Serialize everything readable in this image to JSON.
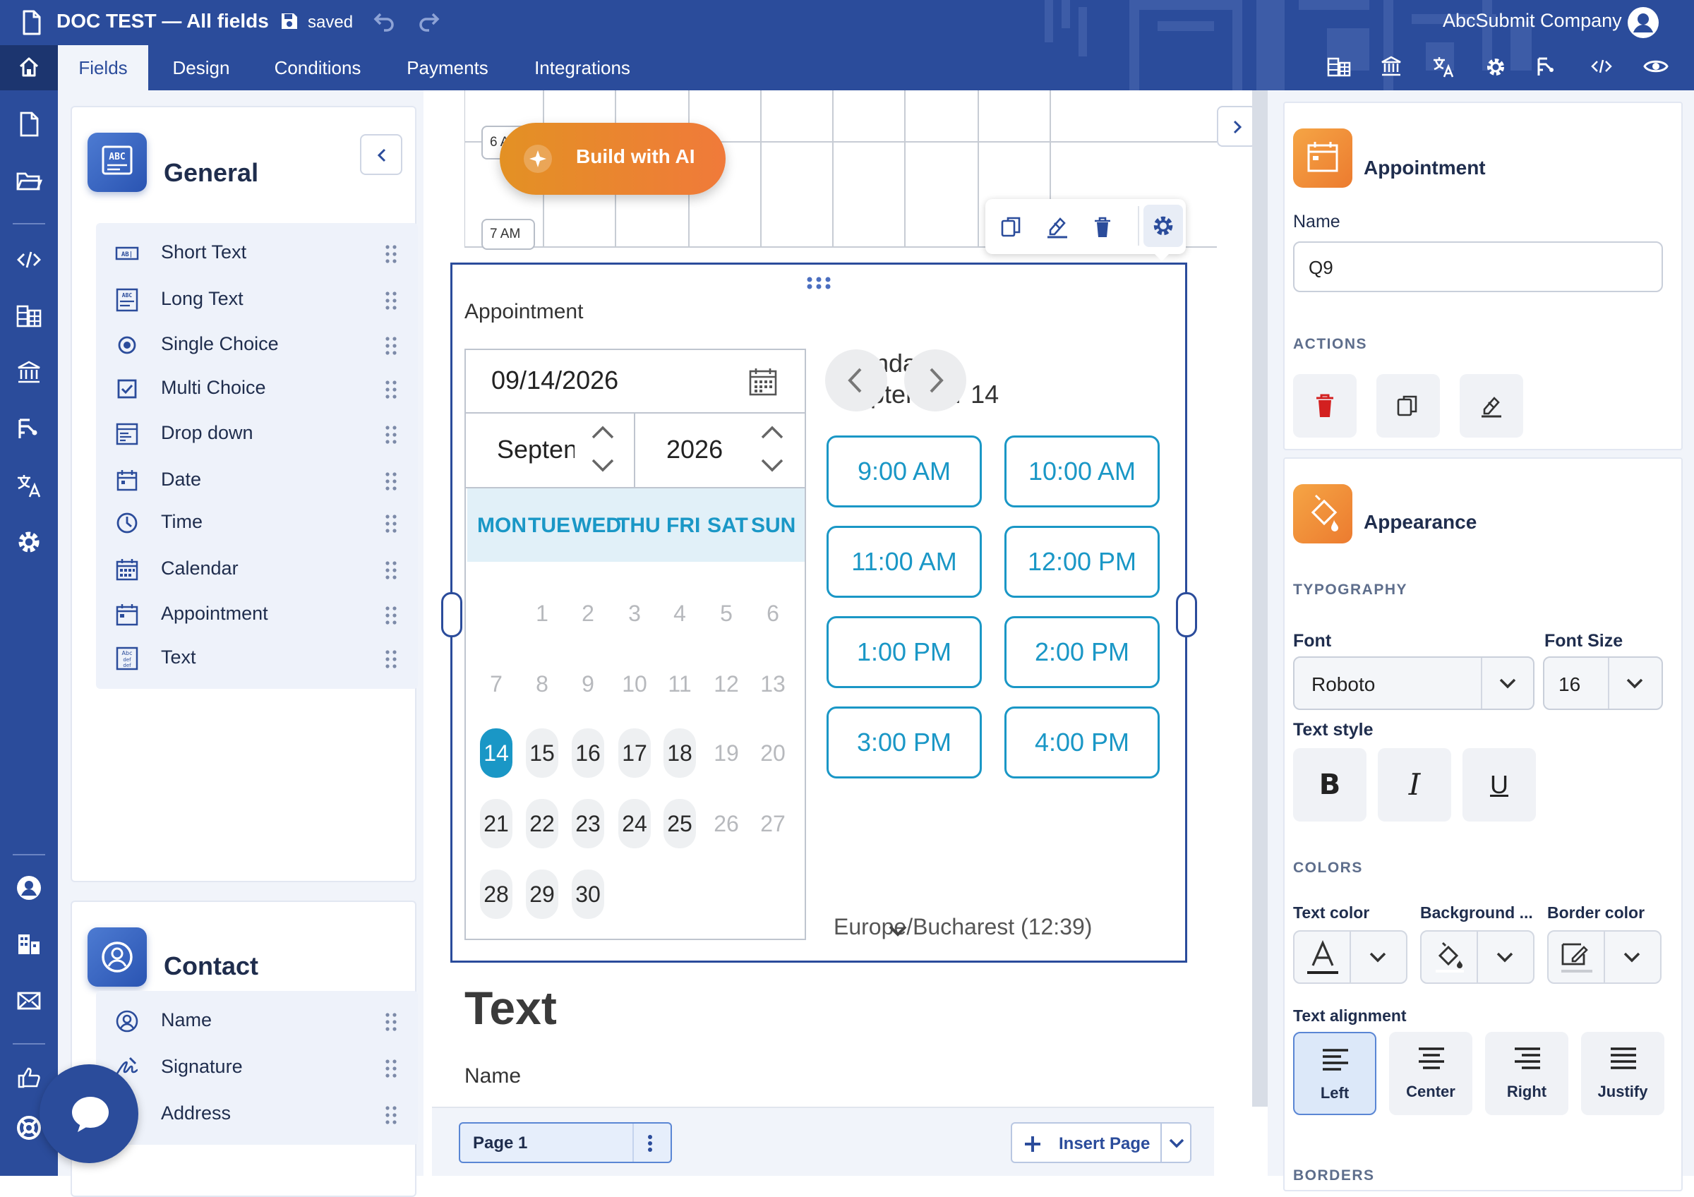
{
  "header": {
    "doc_title": "DOC TEST — All fields",
    "save_status": "saved",
    "company": "AbcSubmit Company",
    "tabs": [
      "Fields",
      "Design",
      "Conditions",
      "Payments",
      "Integrations"
    ],
    "active_tab": "Fields",
    "toolbar_icons": [
      "table-icon",
      "bank-icon",
      "translate-icon",
      "gear-icon",
      "flow-icon",
      "code-icon",
      "eye-icon"
    ]
  },
  "rail": {
    "icons": [
      "file-icon",
      "folder-icon",
      "code-icon",
      "table-icon",
      "bank-icon",
      "flow-icon",
      "translate-icon",
      "gear-icon",
      "user-icon",
      "building-icon",
      "mail-icon",
      "thumb-icon",
      "help-icon"
    ]
  },
  "fields_panel": {
    "general": {
      "title": "General",
      "items": [
        "Short Text",
        "Long Text",
        "Single Choice",
        "Multi Choice",
        "Drop down",
        "Date",
        "Time",
        "Calendar",
        "Appointment",
        "Text"
      ]
    },
    "contact": {
      "title": "Contact",
      "items": [
        "Name",
        "Signature",
        "Address"
      ]
    }
  },
  "canvas": {
    "prev_rows": [
      "6 AM",
      "7 AM"
    ],
    "build_ai_label": "Build with AI",
    "field": {
      "label": "Appointment",
      "date_value": "09/14/2026",
      "month_value": "Septen",
      "year_value": "2026",
      "weekdays": [
        "MON",
        "TUE",
        "WED",
        "THU",
        "FRI",
        "SAT",
        "SUN"
      ],
      "calendar_weeks": [
        [
          "",
          "1",
          "2",
          "3",
          "4",
          "5",
          "6"
        ],
        [
          "7",
          "8",
          "9",
          "10",
          "11",
          "12",
          "13"
        ],
        [
          "14",
          "15",
          "16",
          "17",
          "18",
          "19",
          "20"
        ],
        [
          "21",
          "22",
          "23",
          "24",
          "25",
          "26",
          "27"
        ],
        [
          "28",
          "29",
          "30",
          "",
          "",
          "",
          ""
        ]
      ],
      "selected_day": "14",
      "selected_date_line1": "Monday,",
      "selected_date_line2": "September 14",
      "time_slots": [
        "9:00 AM",
        "10:00 AM",
        "11:00 AM",
        "12:00 PM",
        "1:00 PM",
        "2:00 PM",
        "3:00 PM",
        "4:00 PM"
      ],
      "timezone": "Europe/Bucharest (12:39)"
    },
    "text_heading": "Text",
    "next_field_label": "Name",
    "page_label": "Page 1",
    "insert_page_label": "Insert Page"
  },
  "properties": {
    "element_title": "Appointment",
    "name_label": "Name",
    "name_value": "Q9",
    "actions_label": "ACTIONS",
    "appearance_title": "Appearance",
    "typography_label": "TYPOGRAPHY",
    "font_label": "Font",
    "font_value": "Roboto",
    "font_size_label": "Font Size",
    "font_size_value": "16",
    "text_style_label": "Text style",
    "text_style_buttons": [
      "B",
      "I",
      "U"
    ],
    "colors_label": "COLORS",
    "text_color_label": "Text color",
    "background_label": "Background ...",
    "border_color_label": "Border color",
    "alignment_label": "Text alignment",
    "alignments": [
      "Left",
      "Center",
      "Right",
      "Justify"
    ],
    "active_alignment": "Left",
    "borders_label": "BORDERS"
  },
  "colors": {
    "brand": "#2b4c9b",
    "accent": "#1a97c6",
    "ai_gradient_start": "#e39124",
    "ai_gradient_end": "#f07a3a",
    "delete_red": "#d32020"
  }
}
